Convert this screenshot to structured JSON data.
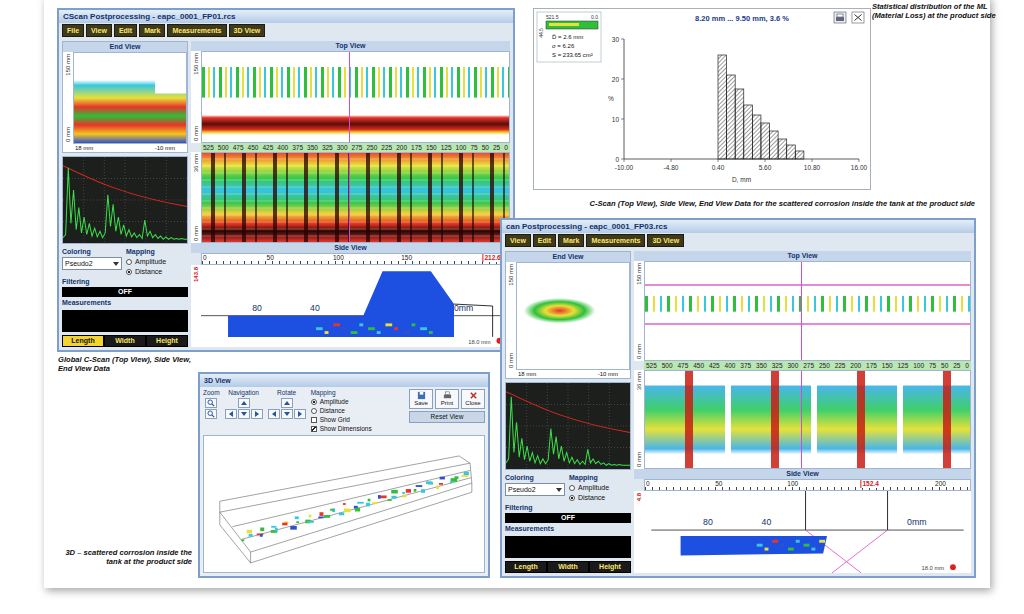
{
  "scan_windows": [
    {
      "title": "CScan Postprocessing - eapc_0001_FP01.rcs",
      "menu": [
        "File",
        "View",
        "Edit",
        "Mark",
        "Measurements",
        "3D View"
      ],
      "end_view": {
        "title": "End View",
        "v_top": "150 mm",
        "v_bottom": "0 mm",
        "h_left": "18 mm",
        "h_right": "-10 mm"
      },
      "top_view": {
        "title": "Top View",
        "v_top": "150 mm",
        "v_bottom": "0 mm",
        "lower_v_top": "36 mm",
        "lower_v_bottom": "0 mm",
        "ticks": [
          "525",
          "500",
          "475",
          "450",
          "425",
          "400",
          "375",
          "350",
          "325",
          "300",
          "275",
          "250",
          "225",
          "200",
          "175",
          "150",
          "125",
          "100",
          "75",
          "50",
          "25",
          "0"
        ]
      },
      "side_view": {
        "title": "Side View",
        "ruler": [
          "0",
          "50",
          "100",
          "150"
        ],
        "marker": "212.6",
        "depth": "143.8",
        "labels": [
          "80",
          "40",
          "0mm"
        ],
        "corner": "18.0 mm"
      },
      "ascan": [
        4,
        8,
        92,
        22,
        64,
        14,
        42,
        10,
        30,
        8,
        22,
        6,
        16,
        5,
        12,
        4,
        10,
        58,
        18,
        46,
        12,
        30,
        8,
        20,
        6,
        14,
        5,
        10,
        4,
        8,
        3,
        26,
        6,
        12,
        4,
        8,
        3,
        6,
        2,
        5,
        2,
        4,
        2,
        3,
        2,
        3,
        2,
        2
      ],
      "coloring": {
        "label": "Coloring",
        "value": "Pseudo2"
      },
      "mapping": {
        "label": "Mapping",
        "options": [
          {
            "label": "Amplitude",
            "selected": false
          },
          {
            "label": "Distance",
            "selected": true
          }
        ]
      },
      "filtering": {
        "label": "Filtering",
        "value": "OFF"
      },
      "measurements": {
        "label": "Measurements",
        "buttons": [
          {
            "label": "Length",
            "selected": true
          },
          {
            "label": "Width",
            "selected": false
          },
          {
            "label": "Height",
            "selected": false
          }
        ]
      }
    },
    {
      "title": "can Postprocessing - eapc_0001_FP03.rcs",
      "menu": [
        "View",
        "Edit",
        "Mark",
        "Measurements",
        "3D View"
      ],
      "end_view": {
        "title": "End View",
        "v_top": "150 mm",
        "v_bottom": "0 mm",
        "h_left": "18 mm",
        "h_right": "-10 mm"
      },
      "top_view": {
        "title": "Top View",
        "v_top": "150 mm",
        "v_bottom": "0 mm",
        "lower_v_top": "36 mm",
        "lower_v_bottom": "0 mm",
        "ticks": [
          "525",
          "500",
          "475",
          "450",
          "425",
          "400",
          "375",
          "350",
          "325",
          "300",
          "275",
          "250",
          "225",
          "200",
          "175",
          "150",
          "125",
          "100",
          "75",
          "50",
          "25",
          "0"
        ]
      },
      "side_view": {
        "title": "Side View",
        "ruler": [
          "0",
          "50",
          "100",
          "200"
        ],
        "marker": "152.4",
        "depth": "4.8",
        "labels": [
          "80",
          "40",
          "0mm"
        ],
        "corner": "18.0 mm"
      },
      "ascan": [
        5,
        10,
        88,
        18,
        56,
        12,
        36,
        9,
        26,
        7,
        18,
        5,
        14,
        4,
        10,
        4,
        9,
        48,
        16,
        38,
        10,
        26,
        7,
        18,
        5,
        12,
        4,
        9,
        3,
        7,
        3,
        22,
        5,
        10,
        4,
        7,
        3,
        5,
        2,
        4,
        2,
        3,
        2,
        3,
        2,
        2,
        2,
        2
      ],
      "coloring": {
        "label": "Coloring",
        "value": "Pseudo2"
      },
      "mapping": {
        "label": "Mapping",
        "options": [
          {
            "label": "Amplitude",
            "selected": false
          },
          {
            "label": "Distance",
            "selected": true
          }
        ]
      },
      "filtering": {
        "label": "Filtering",
        "value": "OFF"
      },
      "measurements": {
        "label": "Measurements",
        "buttons": [
          {
            "label": "Length",
            "selected": false
          },
          {
            "label": "Width",
            "selected": false
          },
          {
            "label": "Height",
            "selected": false
          }
        ]
      }
    }
  ],
  "histogram": {
    "header": "8.20 mm ... 9.50 mm, 3.6 %",
    "strip_left": "521.5",
    "strip_right": "0.0",
    "strip_depth": "44.5",
    "stats": [
      "D̄ = 2.6 mm",
      "σ = 6.26",
      "S = 233.65 cm²"
    ],
    "y_ticks": [
      "0",
      "10",
      "20",
      "30"
    ],
    "y_unit": "%",
    "x_ticks": [
      "-10.00",
      "-4.80",
      "0.40",
      "5.60",
      "10.80",
      "16.00"
    ],
    "x_label": "D, mm",
    "bar_start": 0.4,
    "bar_width": 0.95,
    "bars": [
      26,
      21,
      17.5,
      13.5,
      11,
      9,
      7,
      5,
      3.5,
      2
    ]
  },
  "view3d": {
    "title": "3D View",
    "zoom": "Zoom",
    "navigation": "Navigation",
    "rotate": "Rotate",
    "mapping": {
      "label": "Mapping",
      "options": [
        {
          "label": "Amplitude",
          "selected": true
        },
        {
          "label": "Distance",
          "selected": false
        }
      ]
    },
    "checks": [
      {
        "label": "Show Grid",
        "checked": false
      },
      {
        "label": "Show Dimensions",
        "checked": true
      }
    ],
    "buttons": [
      "Save",
      "Print",
      "Close"
    ],
    "reset": "Reset View"
  },
  "captions": {
    "histogram": "Statistical distribution of the ML (Material Loss) at the product side",
    "cscan": "C-Scan (Top View), Side View, End View Data for the scattered corrosion inside the tank at the product side",
    "global": "Global C-Scan (Top View), Side View, End View Data",
    "view3d": "3D – scattered corrosion inside the tank at the product side"
  }
}
